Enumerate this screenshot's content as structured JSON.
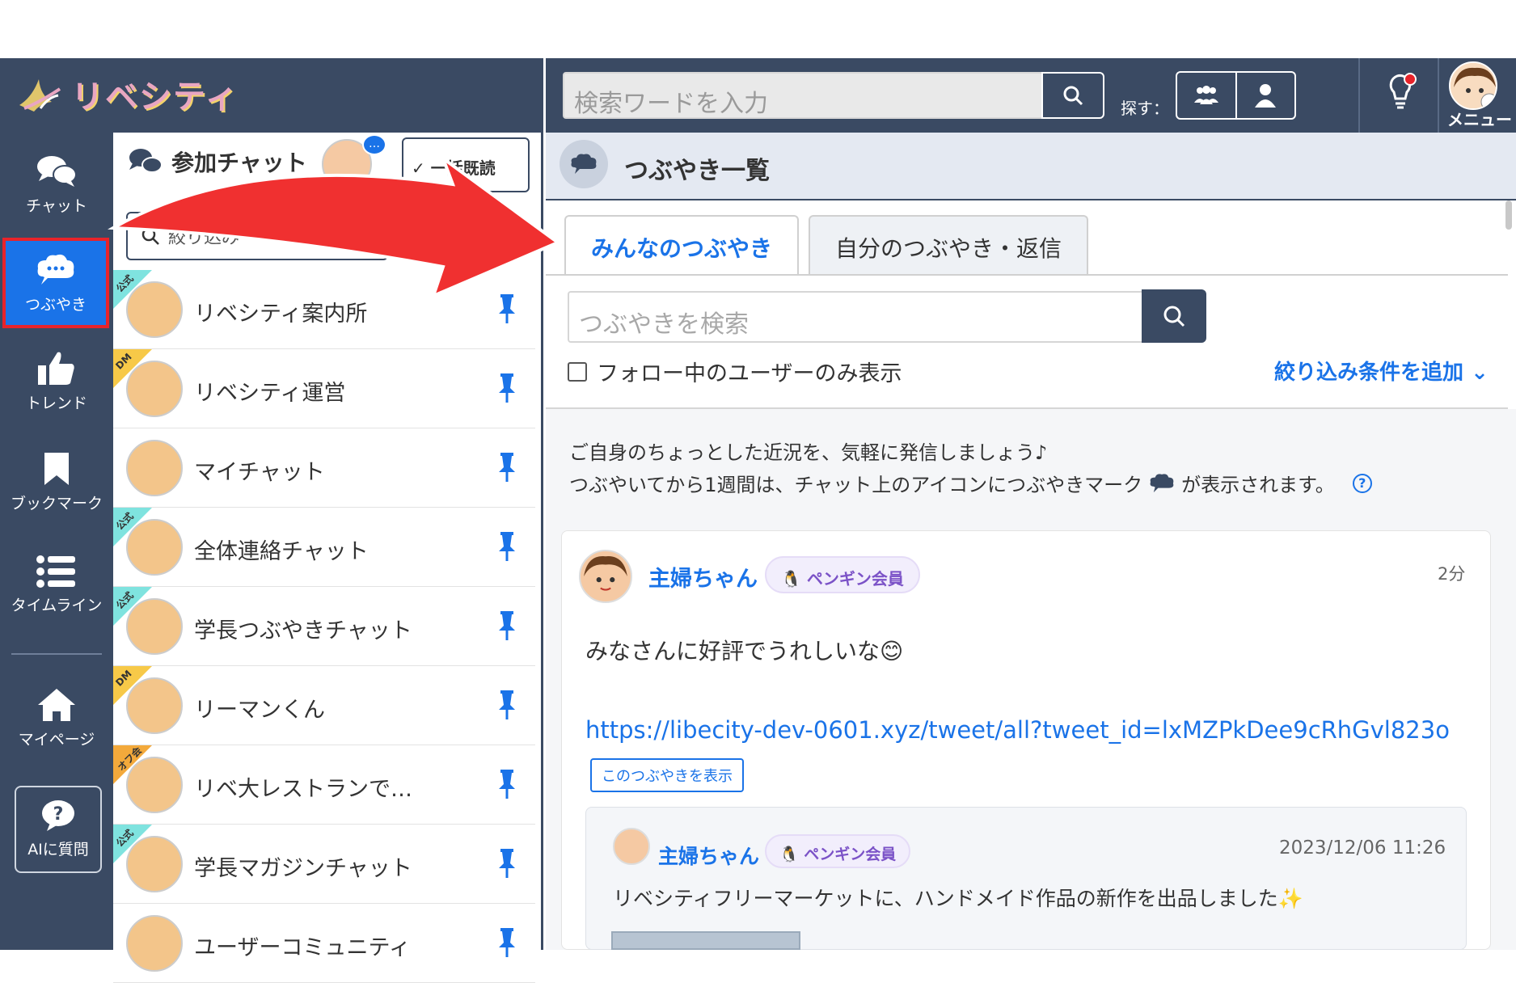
{
  "header": {
    "logo_text": "リベシティ",
    "search_placeholder": "検索ワードを入力",
    "explore_label": "探す：",
    "menu_label": "メニュー"
  },
  "rail": {
    "items": [
      {
        "label": "チャット",
        "icon": "chat-bubbles-icon"
      },
      {
        "label": "つぶやき",
        "icon": "tweet-bubble-icon",
        "active": true
      },
      {
        "label": "トレンド",
        "icon": "thumbs-up-icon"
      },
      {
        "label": "ブックマーク",
        "icon": "bookmark-icon"
      },
      {
        "label": "タイムライン",
        "icon": "list-icon"
      },
      {
        "label": "マイページ",
        "icon": "home-icon"
      }
    ],
    "ai_button": "AIに質問"
  },
  "chatlist": {
    "title": "参加チャット",
    "bulk_read_label": "一括既読",
    "filter_placeholder": "絞り込み",
    "rows": [
      {
        "name": "リベシティ案内所",
        "tag": "公式",
        "tag_color": "#7fe3df"
      },
      {
        "name": "リベシティ運営",
        "tag": "DM",
        "tag_color": "#f7c948"
      },
      {
        "name": "マイチャット",
        "tag": "",
        "tag_color": ""
      },
      {
        "name": "全体連絡チャット",
        "tag": "公式",
        "tag_color": "#7fe3df"
      },
      {
        "name": "学長つぶやきチャット",
        "tag": "公式",
        "tag_color": "#7fe3df"
      },
      {
        "name": "リーマンくん",
        "tag": "DM",
        "tag_color": "#f7c948"
      },
      {
        "name": "リベ大レストランで…",
        "tag": "オフ会",
        "tag_color": "#f3a93b"
      },
      {
        "name": "学長マガジンチャット",
        "tag": "公式",
        "tag_color": "#7fe3df"
      },
      {
        "name": "ユーザーコミュニティ",
        "tag": "",
        "tag_color": ""
      }
    ]
  },
  "main": {
    "title": "つぶやき一覧",
    "tabs": [
      "みんなのつぶやき",
      "自分のつぶやき・返信"
    ],
    "search_placeholder": "つぶやきを検索",
    "follow_only_label": "フォロー中のユーザーのみ表示",
    "add_filter_label": "絞り込み条件を追加",
    "info_line1": "ご自身のちょっとした近況を、気軽に発信しましょう♪",
    "info_line2_a": "つぶやいてから1週間は、チャット上のアイコンにつぶやきマーク",
    "info_line2_b": "が表示されます。",
    "post": {
      "user": "主婦ちゃん",
      "badge": "ペンギン会員",
      "time": "2分",
      "text": "みなさんに好評でうれしいな😊",
      "link": "https://libecity-dev-0601.xyz/tweet/all?tweet_id=lxMZPkDee9cRhGvl823o",
      "show_button": "このつぶやきを表示"
    },
    "quote": {
      "user": "主婦ちゃん",
      "badge": "ペンギン会員",
      "time": "2023/12/06 11:26",
      "text": "リベシティフリーマーケットに、ハンドメイド作品の新作を出品しました✨"
    }
  },
  "colors": {
    "navy": "#3a4a63",
    "accent_blue": "#1a73e8",
    "annotation_red": "#e8232a"
  }
}
